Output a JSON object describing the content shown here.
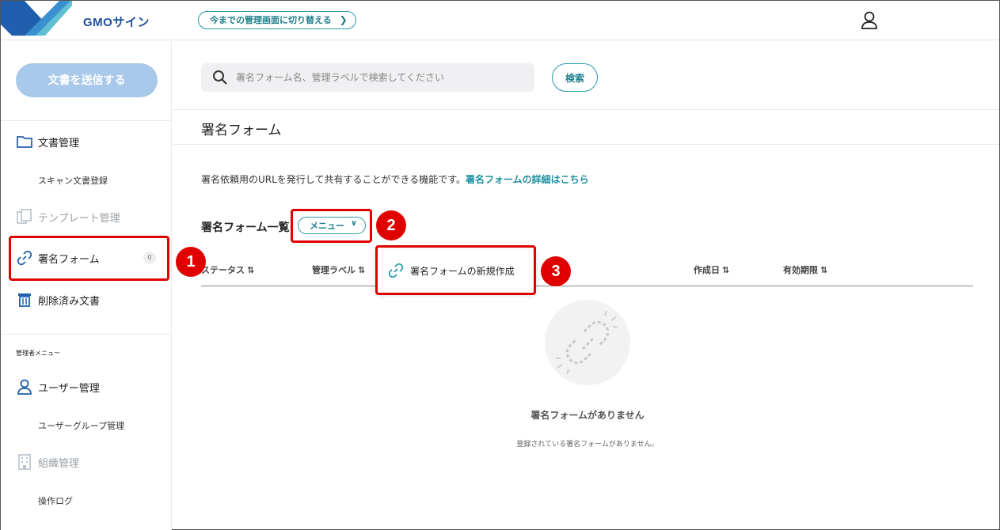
{
  "header": {
    "logo_text": "GMOサイン",
    "switch_button": "今までの管理画面に切り替える",
    "brand_colors": {
      "primary": "#1f4f9c",
      "accent": "#2b9aa8",
      "light": "#5fc0d2"
    }
  },
  "sidebar": {
    "send_button": "文書を送信する",
    "items": [
      {
        "label": "文書管理",
        "icon": "folder-icon"
      },
      {
        "label": "スキャン文書登録"
      },
      {
        "label": "テンプレート管理",
        "icon": "template-icon"
      },
      {
        "label": "署名フォーム",
        "icon": "link-icon",
        "badge": "0"
      },
      {
        "label": "削除済み文書",
        "icon": "trash-icon"
      }
    ],
    "admin_section_label": "管理者メニュー",
    "admin_items": [
      {
        "label": "ユーザー管理",
        "icon": "user-icon"
      },
      {
        "label": "ユーザーグループ管理"
      },
      {
        "label": "組織管理",
        "icon": "building-icon"
      },
      {
        "label": "操作ログ"
      }
    ]
  },
  "main": {
    "search": {
      "placeholder": "署名フォーム名、管理ラベルで検索してください",
      "button": "検索"
    },
    "page_title": "署名フォーム",
    "description": "署名依頼用のURLを発行して共有することができる機能です。",
    "description_link": "署名フォームの詳細はこちら",
    "list_title": "署名フォーム一覧",
    "menu_button": "メニュー",
    "dropdown_item": "署名フォームの新規作成",
    "columns": [
      "ステータス",
      "管理ラベル",
      "作成日",
      "有効期限"
    ],
    "empty_title": "署名フォームがありません",
    "empty_sub": "登録されている署名フォームがありません。"
  },
  "annotations": [
    "1",
    "2",
    "3"
  ]
}
